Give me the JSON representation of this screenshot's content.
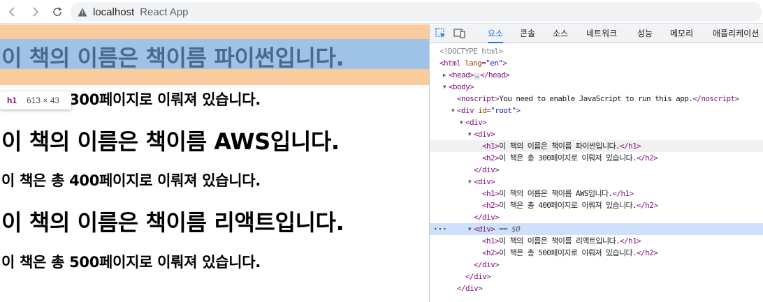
{
  "browser": {
    "host": "localhost",
    "title": "React App"
  },
  "page": {
    "books": [
      {
        "h1": "이 책의 이름은 책이름 파이썬입니다.",
        "h2": "이 책은 총 300페이지로 이뤄져 있습니다."
      },
      {
        "h1": "이 책의 이름은 책이름 AWS입니다.",
        "h2": "이 책은 총 400페이지로 이뤄져 있습니다."
      },
      {
        "h1": "이 책의 이름은 책이름 리액트입니다.",
        "h2": "이 책은 총 500페이지로 이뤄져 있습니다."
      }
    ],
    "tooltip": {
      "tag": "h1",
      "size": "613 × 43"
    }
  },
  "devtools": {
    "tabs": [
      "요소",
      "콘솔",
      "소스",
      "네트워크",
      "성능",
      "메모리",
      "애플리케이션"
    ],
    "active_tab": "요소",
    "tree": {
      "doctype": "<!DOCTYPE html>",
      "html_open": "<html",
      "lang_attr": "lang",
      "lang_val": "\"en\"",
      "head": "<head>",
      "head_ellipsis": "…",
      "head_close": "</head>",
      "body": "<body>",
      "noscript_open": "<noscript>",
      "noscript_text": "You need to enable JavaScript to run this app.",
      "noscript_close": "</noscript>",
      "div_id_open": "<div",
      "id_attr": "id",
      "id_val": "\"root\"",
      "div": "<div>",
      "div_close": "</div>",
      "h1_open": "<h1>",
      "h1_close": "</h1>",
      "h2_open": "<h2>",
      "h2_close": "</h2>",
      "h1_1": "이 책의 이름은 책이름 파이썬입니다.",
      "h2_1": "이 책은 총 300페이지로 이뤄져 있습니다.",
      "h1_2": "이 책의 이름은 책이름 AWS입니다.",
      "h2_2": "이 책은 총 400페이지로 이뤄져 있습니다.",
      "h1_3": "이 책의 이름은 책이름 리액트입니다.",
      "h2_3": "이 책은 총 500페이지로 이뤄져 있습니다.",
      "dollar_ref": "== $0",
      "row_dots": "···"
    }
  }
}
